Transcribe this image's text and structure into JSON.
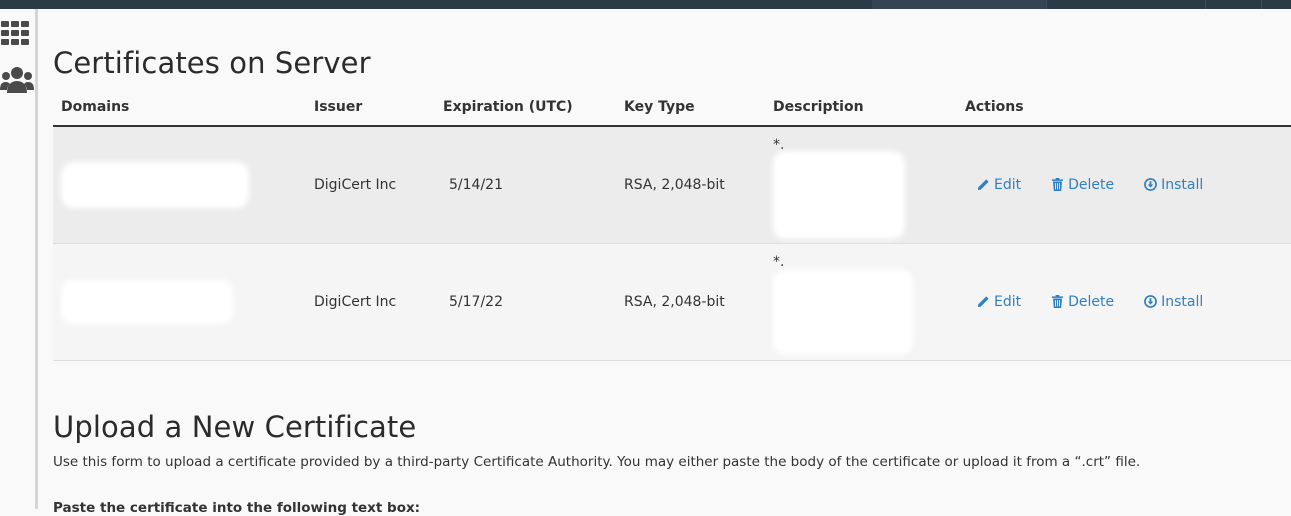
{
  "sidebar": {
    "icons": [
      "apps-grid-icon",
      "users-icon"
    ]
  },
  "certificates": {
    "title": "Certificates on Server",
    "headers": {
      "domains": "Domains",
      "issuer": "Issuer",
      "expiration": "Expiration (UTC)",
      "key_type": "Key Type",
      "description": "Description",
      "actions": "Actions"
    },
    "rows": [
      {
        "issuer": "DigiCert Inc",
        "expiration": "5/14/21",
        "key_type": "RSA, 2,048-bit",
        "description_prefix": "*.",
        "actions": {
          "edit": "Edit",
          "delete": "Delete",
          "install": "Install"
        }
      },
      {
        "issuer": "DigiCert Inc",
        "expiration": "5/17/22",
        "key_type": "RSA, 2,048-bit",
        "description_prefix": "*.",
        "actions": {
          "edit": "Edit",
          "delete": "Delete",
          "install": "Install"
        }
      }
    ]
  },
  "upload": {
    "title": "Upload a New Certificate",
    "description": "Use this form to upload a certificate provided by a third-party Certificate Authority. You may either paste the body of the certificate or upload it from a “.crt” file.",
    "paste_label": "Paste the certificate into the following text box:"
  },
  "colors": {
    "link": "#2f7fc1",
    "topbar": "#2c3a47",
    "row_odd": "#ececec",
    "row_even": "#f5f5f5"
  }
}
